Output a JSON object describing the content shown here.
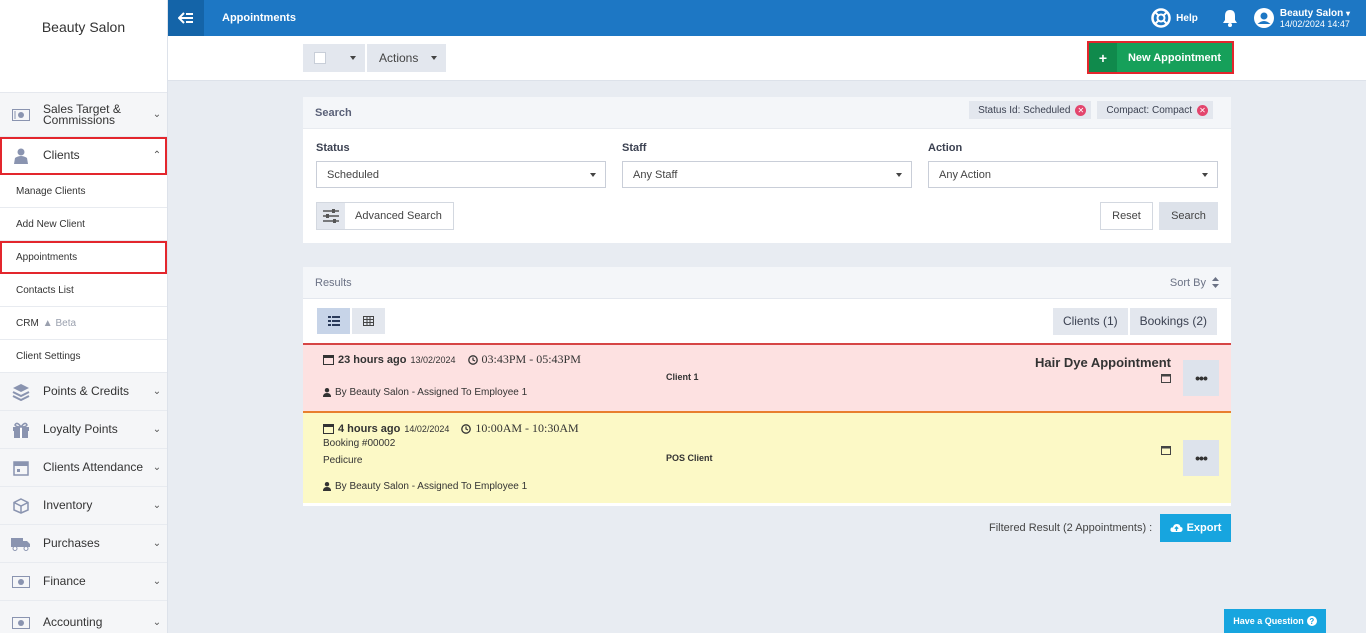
{
  "sidebar": {
    "brand": "Beauty Salon",
    "items": [
      {
        "label": "Sales Target & Commissions",
        "icon": "money-icon"
      },
      {
        "label": "Clients",
        "icon": "user-icon"
      },
      {
        "label": "Points & Credits",
        "icon": "layers-icon"
      },
      {
        "label": "Loyalty Points",
        "icon": "gift-icon"
      },
      {
        "label": "Clients Attendance",
        "icon": "calendar-icon"
      },
      {
        "label": "Inventory",
        "icon": "box-icon"
      },
      {
        "label": "Purchases",
        "icon": "truck-icon"
      },
      {
        "label": "Finance",
        "icon": "money-icon"
      },
      {
        "label": "Accounting",
        "icon": "money-icon"
      }
    ],
    "sub_items": [
      "Manage Clients",
      "Add New Client",
      "Appointments",
      "Contacts List",
      "CRM",
      "Client Settings"
    ],
    "crm_beta": "Beta"
  },
  "topbar": {
    "title": "Appointments",
    "help": "Help",
    "user_name": "Beauty Salon",
    "datetime": "14/02/2024 14:47"
  },
  "toolbar": {
    "actions_label": "Actions",
    "new_appointment_label": "New Appointment"
  },
  "search": {
    "title": "Search",
    "chips": [
      "Status Id: Scheduled",
      "Compact: Compact"
    ],
    "status_label": "Status",
    "status_value": "Scheduled",
    "staff_label": "Staff",
    "staff_value": "Any Staff",
    "action_label": "Action",
    "action_value": "Any Action",
    "advanced_label": "Advanced Search",
    "reset_label": "Reset",
    "search_label": "Search"
  },
  "results": {
    "title": "Results",
    "sort_by": "Sort By",
    "tab_clients": "Clients (1)",
    "tab_bookings": "Bookings (2)",
    "appointments": [
      {
        "ago": "23 hours ago",
        "date": "13/02/2024",
        "time": "03:43PM - 05:43PM",
        "by": "By Beauty Salon - Assigned To Employee 1",
        "client": "Client 1",
        "service": "Hair Dye Appointment",
        "status_color": "#fde1e1"
      },
      {
        "ago": "4 hours ago",
        "date": "14/02/2024",
        "time": "10:00AM - 10:30AM",
        "booking": "Booking #00002",
        "service": "Pedicure",
        "by": "By Beauty Salon - Assigned To Employee 1",
        "client": "POS Client",
        "status_color": "#fcf9c6"
      }
    ],
    "filtered_text": "Filtered Result (2 Appointments) :",
    "export_label": "Export"
  },
  "have_question": "Have a Question",
  "colors": {
    "topbar": "#1d77c4",
    "new_button": "#16a05a",
    "highlight": "#e3262d",
    "export": "#17a5df"
  }
}
